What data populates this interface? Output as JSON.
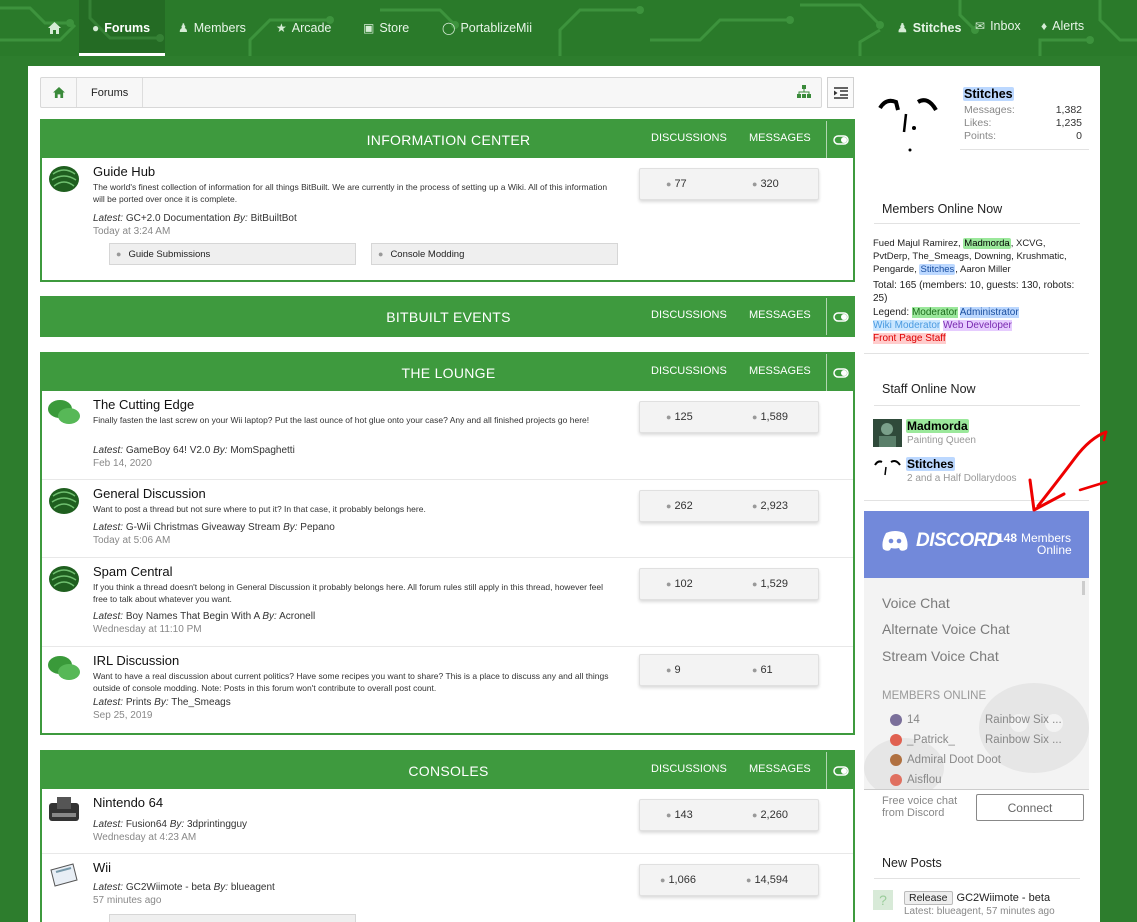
{
  "nav": {
    "items": [
      {
        "label": "",
        "icon": "home-icon"
      },
      {
        "label": "Forums",
        "icon": "comments-icon",
        "active": true
      },
      {
        "label": "Members",
        "icon": "users-icon"
      },
      {
        "label": "Arcade",
        "icon": "trophy-icon"
      },
      {
        "label": "Store",
        "icon": "cart-icon"
      },
      {
        "label": "PortablizeMii",
        "icon": "gamepad-icon"
      }
    ],
    "user": "Stitches",
    "inbox": "Inbox",
    "alerts": "Alerts"
  },
  "breadcrumb": {
    "item": "Forums"
  },
  "categories": [
    {
      "title": "INFORMATION CENTER",
      "col_discussions": "DISCUSSIONS",
      "col_messages": "MESSAGES",
      "forums": [
        {
          "title": "Guide Hub",
          "desc": "The world's finest collection of information for all things BitBuilt. We are currently in the process of setting up a Wiki. All of this information will be ported over once it is complete.",
          "latest_label": "Latest:",
          "latest": "GC+2.0 Documentation",
          "by_label": "By:",
          "by": "BitBuiltBot",
          "date": "Today at 3:24 AM",
          "discussions": "77",
          "messages": "320"
        }
      ],
      "subforums": [
        "Guide Submissions",
        "Console Modding"
      ]
    },
    {
      "title": "BITBUILT EVENTS",
      "col_discussions": "DISCUSSIONS",
      "col_messages": "MESSAGES"
    },
    {
      "title": "THE LOUNGE",
      "col_discussions": "DISCUSSIONS",
      "col_messages": "MESSAGES",
      "forums": [
        {
          "title": "The Cutting Edge",
          "desc": "Finally fasten the last screw on your Wii laptop? Put the last ounce of hot glue onto your case? Any and all finished projects go here!",
          "latest_label": "Latest:",
          "latest": "GameBoy 64! V2.0",
          "by_label": "By:",
          "by": "MomSpaghetti",
          "date": "Feb 14, 2020",
          "discussions": "125",
          "messages": "1,589"
        },
        {
          "title": "General Discussion",
          "desc": "Want to post a thread but not sure where to put it? In that case, it probably belongs here.",
          "latest_label": "Latest:",
          "latest": "G-Wii Christmas Giveaway Stream",
          "by_label": "By:",
          "by": "Pepano",
          "date": "Today at 5:06 AM",
          "discussions": "262",
          "messages": "2,923"
        },
        {
          "title": "Spam Central",
          "desc": "If you think a thread doesn't belong in General Discussion it probably belongs here. All forum rules still apply in this thread, however feel free to talk about whatever you want.",
          "latest_label": "Latest:",
          "latest": "Boy Names That Begin With A",
          "by_label": "By:",
          "by": "Acronell",
          "date": "Wednesday at 11:10 PM",
          "discussions": "102",
          "messages": "1,529"
        },
        {
          "title": "IRL Discussion",
          "desc": "Want to have a real discussion about current politics? Have some recipes you want to share? This is a place to discuss any and all things outside of console modding. Note: Posts in this forum won't contribute to overall post count.",
          "latest_label": "Latest:",
          "latest": "Prints",
          "by_label": "By:",
          "by": "The_Smeags",
          "date": "Sep 25, 2019",
          "discussions": "9",
          "messages": "61"
        }
      ]
    },
    {
      "title": "CONSOLES",
      "col_discussions": "DISCUSSIONS",
      "col_messages": "MESSAGES",
      "forums": [
        {
          "title": "Nintendo 64",
          "latest_label": "Latest:",
          "latest": "Fusion64",
          "by_label": "By:",
          "by": "3dprintingguy",
          "date": "Wednesday at 4:23 AM",
          "discussions": "143",
          "messages": "2,260"
        },
        {
          "title": "Wii",
          "latest_label": "Latest:",
          "latest": "GC2Wiimote - beta",
          "by_label": "By:",
          "by": "blueagent",
          "date": "57 minutes ago",
          "discussions": "1,066",
          "messages": "14,594"
        }
      ]
    }
  ],
  "sidebar": {
    "user": {
      "name": "Stitches",
      "messages_label": "Messages:",
      "messages": "1,382",
      "likes_label": "Likes:",
      "likes": "1,235",
      "points_label": "Points:",
      "points": "0"
    },
    "members_online": {
      "title": "Members Online Now",
      "names_pre": "Fued Majul Ramirez, ",
      "mod": "Madmorda",
      "names_mid": ", XCVG, PvtDerp, The_Smeags, Downing, Krushmatic, Pengarde, ",
      "admin": "Stitches",
      "names_post": ", Aaron Miller",
      "total": "Total: 165 (members: 10, guests: 130, robots: 25)",
      "legend_label": "Legend:",
      "legend": [
        "Moderator",
        "Administrator",
        "Wiki Moderator",
        "Web Developer",
        "Front Page Staff"
      ]
    },
    "staff_online": {
      "title": "Staff Online Now",
      "staff": [
        {
          "name": "Madmorda",
          "title": "Painting Queen"
        },
        {
          "name": "Stitches",
          "title": "2 and a Half Dollarydoos"
        }
      ]
    },
    "discord": {
      "logo": "DISCORD",
      "count": "148",
      "members_label": "Members",
      "online_label": "Online",
      "channels": [
        "Voice Chat",
        "Alternate Voice Chat",
        "Stream Voice Chat"
      ],
      "members_title": "MEMBERS ONLINE",
      "members": [
        {
          "name": "14",
          "game": "Rainbow Six ..."
        },
        {
          "name": "_Patrick_",
          "game": "Rainbow Six ..."
        },
        {
          "name": "Admiral Doot Doot",
          "game": ""
        },
        {
          "name": "Aisflou",
          "game": ""
        }
      ],
      "free_text": "Free voice chat from Discord",
      "connect": "Connect"
    },
    "new_posts": {
      "title": "New Posts",
      "items": [
        {
          "prefix": "Release",
          "title": "GC2Wiimote - beta",
          "meta": "Latest: blueagent, 57 minutes ago"
        }
      ]
    }
  },
  "colors": {
    "header": "#2a7a2a",
    "category": "#3e9a3e",
    "discord": "#7289da"
  }
}
